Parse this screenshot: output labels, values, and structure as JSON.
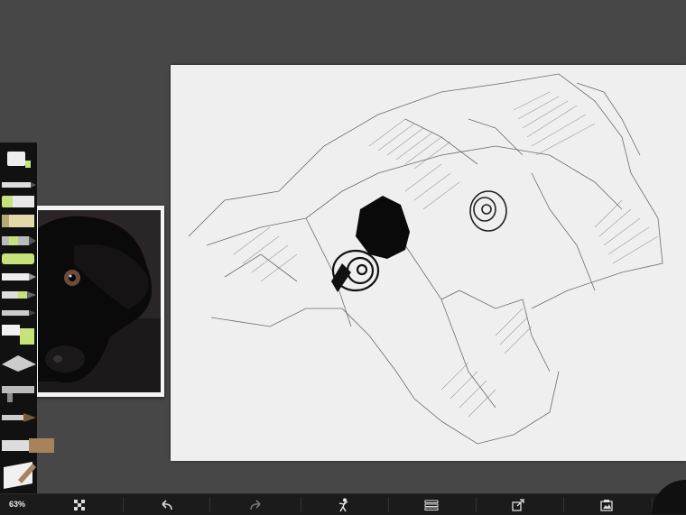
{
  "status": {
    "zoom_level": "63%"
  },
  "toolbar": {
    "items": [
      {
        "name": "transform-button",
        "icon": "transform-icon"
      },
      {
        "name": "undo-button",
        "icon": "undo-arrow-icon"
      },
      {
        "name": "redo-button",
        "icon": "redo-arrow-icon"
      },
      {
        "name": "color-picker-button",
        "icon": "painter-figure-icon"
      },
      {
        "name": "layers-button",
        "icon": "layers-icon"
      },
      {
        "name": "share-button",
        "icon": "export-icon"
      },
      {
        "name": "gallery-button",
        "icon": "gallery-icon"
      }
    ]
  },
  "tools": [
    "paint-tube",
    "pencil",
    "crayon",
    "marker",
    "felt-pen",
    "oil-pastel",
    "ink-pen",
    "chalk",
    "pencil-thin",
    "paint-roller",
    "palette-knife",
    "airbrush",
    "fine-brush",
    "wide-brush",
    "eraser"
  ],
  "colors": {
    "background": "#474747",
    "canvas": "#efefef",
    "tray": "#111111",
    "accent": "#c6e27a"
  }
}
